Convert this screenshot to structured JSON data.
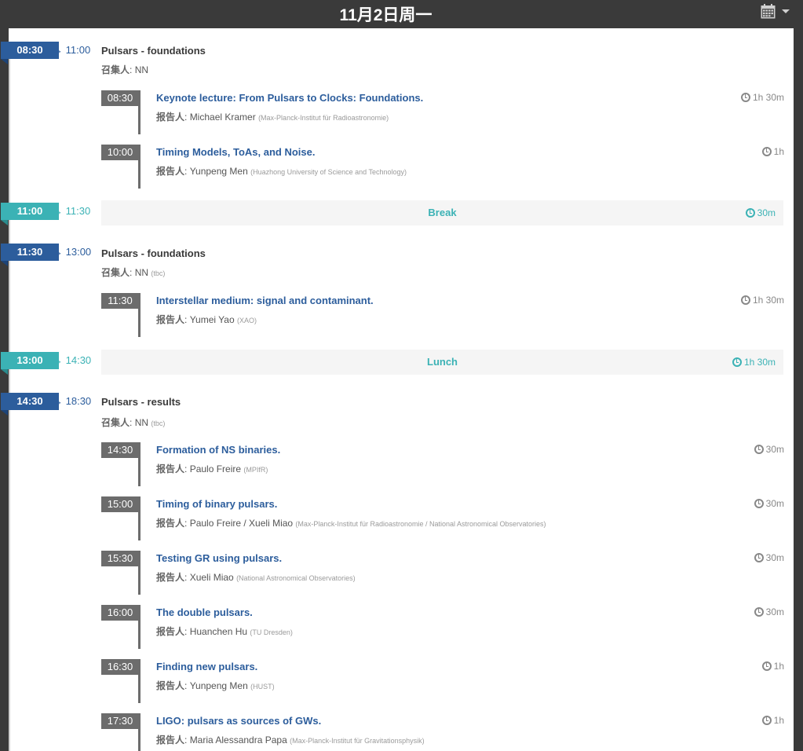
{
  "header": {
    "date": "11月2日周一"
  },
  "arrow": "→",
  "convener_label": "召集人",
  "speaker_label": "报告人",
  "sessions": [
    {
      "start": "08:30",
      "end": "11:00",
      "title": "Pulsars - foundations",
      "convener": "NN",
      "convener_note": "",
      "contributions": [
        {
          "time": "08:30",
          "title": "Keynote lecture: From Pulsars to Clocks: Foundations.",
          "speaker": "Michael Kramer",
          "affiliation": "(Max-Planck-Institut für Radioastronomie)",
          "duration": "1h 30m"
        },
        {
          "time": "10:00",
          "title": "Timing Models, ToAs, and Noise.",
          "speaker": "Yunpeng Men",
          "affiliation": "(Huazhong University of Science and Technology)",
          "duration": "1h"
        }
      ]
    },
    {
      "start": "11:30",
      "end": "13:00",
      "title": "Pulsars - foundations",
      "convener": "NN",
      "convener_note": "(tbc)",
      "contributions": [
        {
          "time": "11:30",
          "title": "Interstellar medium: signal and contaminant.",
          "speaker": "Yumei Yao",
          "affiliation": "(XAO)",
          "duration": "1h 30m"
        }
      ]
    },
    {
      "start": "14:30",
      "end": "18:30",
      "title": "Pulsars - results",
      "convener": "NN",
      "convener_note": "(tbc)",
      "contributions": [
        {
          "time": "14:30",
          "title": "Formation of NS binaries.",
          "speaker": "Paulo Freire",
          "affiliation": "(MPIfR)",
          "duration": "30m"
        },
        {
          "time": "15:00",
          "title": "Timing of binary pulsars.",
          "speaker": "Paulo Freire / Xueli Miao",
          "affiliation": "(Max-Planck-Institut für Radioastronomie / National Astronomical Observatories)",
          "duration": "30m"
        },
        {
          "time": "15:30",
          "title": "Testing GR using pulsars.",
          "speaker": "Xueli Miao",
          "affiliation": "(National Astronomical Observatories)",
          "duration": "30m"
        },
        {
          "time": "16:00",
          "title": "The double pulsars.",
          "speaker": "Huanchen Hu",
          "affiliation": "(TU Dresden)",
          "duration": "30m"
        },
        {
          "time": "16:30",
          "title": "Finding new pulsars.",
          "speaker": "Yunpeng Men",
          "affiliation": "(HUST)",
          "duration": "1h"
        },
        {
          "time": "17:30",
          "title": "LIGO: pulsars as sources of GWs.",
          "speaker": "Maria Alessandra Papa",
          "affiliation": "(Max-Planck-Institut für Gravitationsphysik)",
          "duration": "1h"
        }
      ]
    }
  ],
  "breaks": [
    {
      "start": "11:00",
      "end": "11:30",
      "title": "Break",
      "duration": "30m"
    },
    {
      "start": "13:00",
      "end": "14:30",
      "title": "Lunch",
      "duration": "1h 30m"
    }
  ],
  "colors": {
    "session": "#2c5d9c",
    "break": "#3bb2b5",
    "contrib_time": "#6c6c6c",
    "page_bg": "#3a3a3a"
  },
  "icons": {
    "calendar": "calendar-icon",
    "clock": "clock-icon",
    "dropdown": "chevron-down-icon"
  }
}
